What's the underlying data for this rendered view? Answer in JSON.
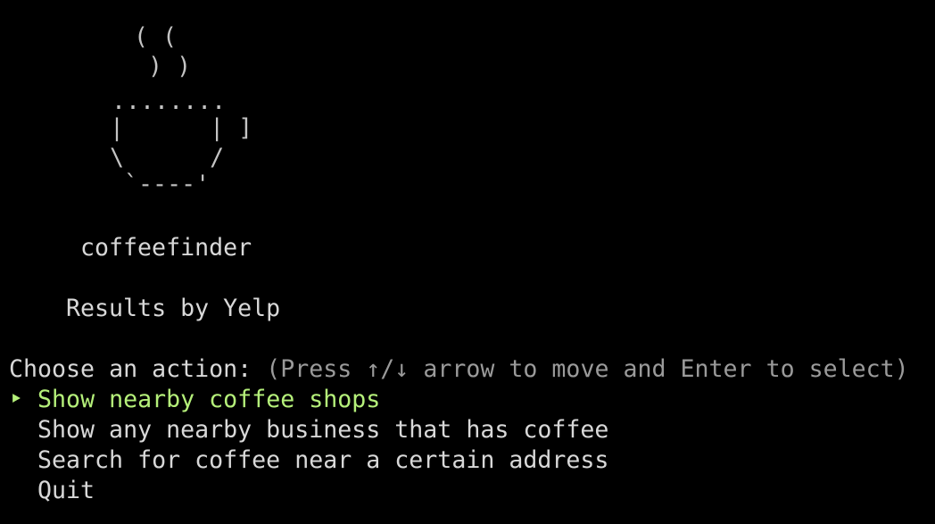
{
  "logo": {
    "art_lines": [
      "    ( (",
      "     ) )",
      "  ........",
      "  |      | ]",
      "  \\      /",
      "   `----'"
    ]
  },
  "app": {
    "name": "coffeefinder",
    "credit": "Results by Yelp"
  },
  "prompt": {
    "label": "Choose an action:",
    "hint": "(Press ↑/↓ arrow to move and Enter to select)"
  },
  "menu": {
    "pointer": "‣",
    "items": [
      {
        "label": "Show nearby coffee shops",
        "selected": true
      },
      {
        "label": "Show any nearby business that has coffee",
        "selected": false
      },
      {
        "label": "Search for coffee near a certain address",
        "selected": false
      },
      {
        "label": "Quit",
        "selected": false
      }
    ]
  },
  "colors": {
    "background": "#000000",
    "text": "#d8d8d8",
    "hint": "#9a9a9a",
    "selected": "#b5f07a"
  }
}
